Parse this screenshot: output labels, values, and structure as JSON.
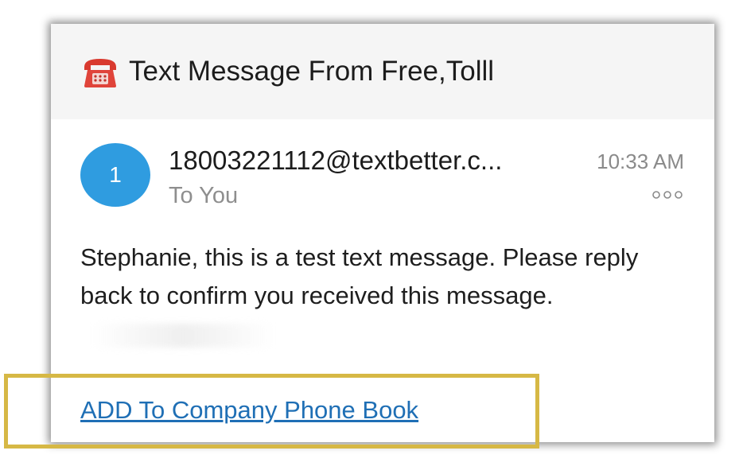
{
  "email": {
    "subject": "Text Message From Free,Tolll",
    "subject_icon": "telephone-icon",
    "avatar_initial": "1",
    "sender": "18003221112@textbetter.c...",
    "recipient": "To You",
    "time": "10:33 AM",
    "more_icon": "more-options-icon",
    "body": "Stephanie, this is a test text message. Please reply back to confirm you received this message.",
    "link": "ADD To Company Phone Book"
  },
  "colors": {
    "avatar": "#2f9ce0",
    "link": "#1f6fb5",
    "highlight": "#d6b845",
    "header_bg": "#f5f5f5"
  }
}
